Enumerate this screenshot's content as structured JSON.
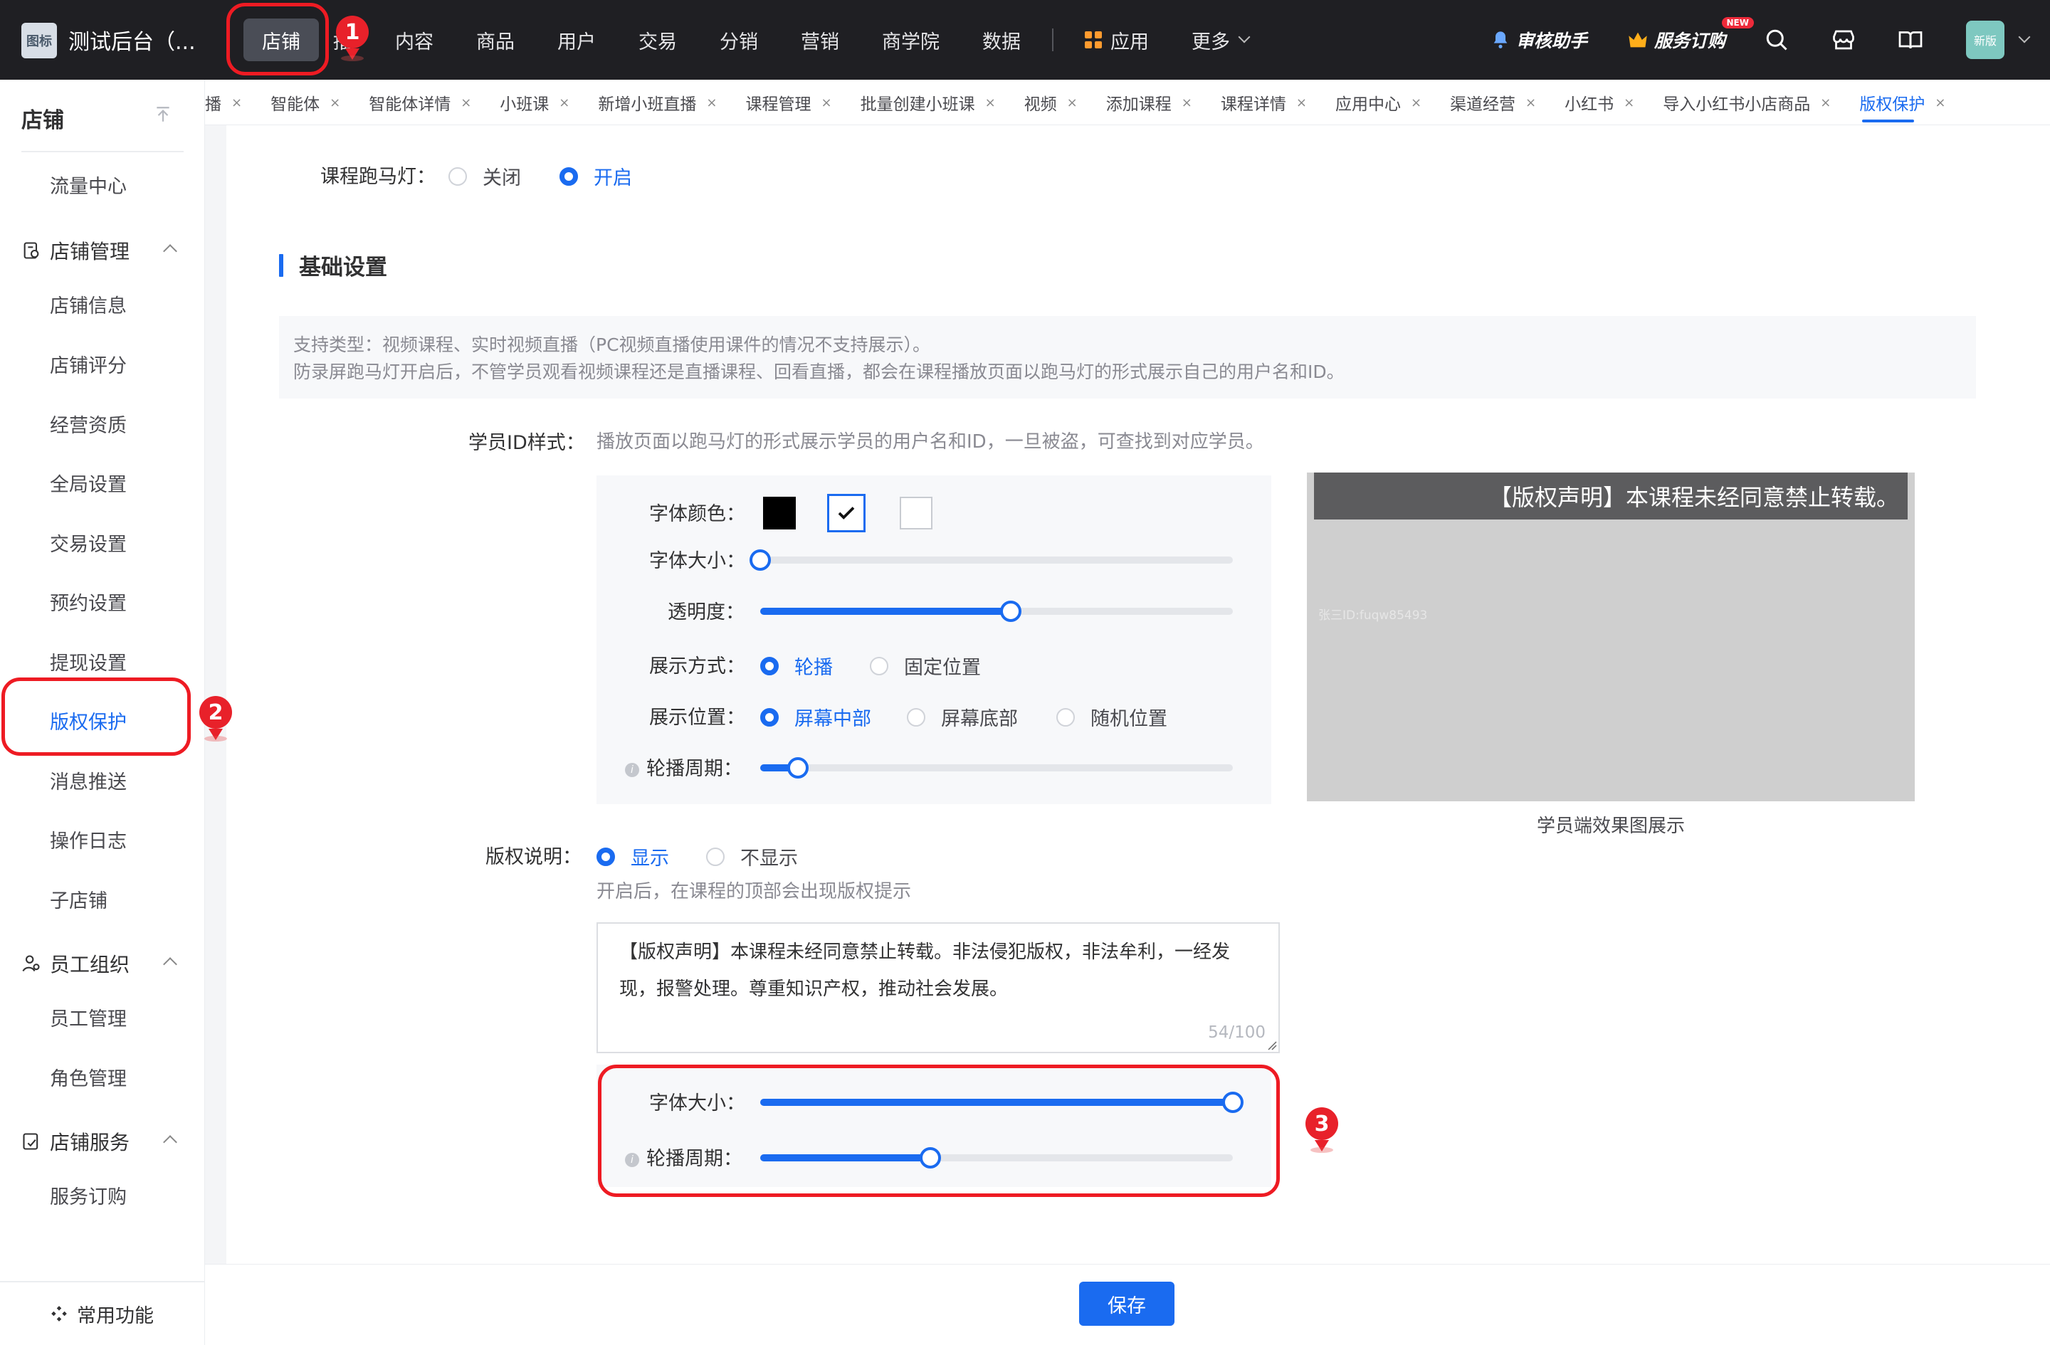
{
  "topnav": {
    "app_title": "测试后台（...",
    "logo_text": "图标",
    "items": [
      {
        "label": "店铺",
        "active": true
      },
      {
        "label": "播"
      },
      {
        "label": "内容"
      },
      {
        "label": "商品"
      },
      {
        "label": "用户"
      },
      {
        "label": "交易"
      },
      {
        "label": "分销"
      },
      {
        "label": "营销"
      },
      {
        "label": "商学院"
      },
      {
        "label": "数据"
      },
      {
        "label": "应用",
        "icon": "apps-grid-icon"
      },
      {
        "label": "更多",
        "icon": "chevron-down-icon"
      }
    ],
    "review_assistant": "审核助手",
    "service_subscribe": "服务订购",
    "new_badge": "NEW",
    "avatar_text": "新版"
  },
  "sidebar": {
    "title": "店铺",
    "items_top": [
      "流量中心"
    ],
    "group_shop_manage": "店铺管理",
    "shop_items": [
      "店铺信息",
      "店铺评分",
      "经营资质",
      "全局设置",
      "交易设置",
      "预约设置",
      "提现设置",
      "版权保护",
      "消息推送",
      "操作日志",
      "子店铺"
    ],
    "group_staff": "员工组织",
    "staff_items": [
      "员工管理",
      "角色管理"
    ],
    "group_service": "店铺服务",
    "service_items": [
      "服务订购"
    ],
    "bottom": "常用功能"
  },
  "tabs": [
    "播",
    "智能体",
    "智能体详情",
    "小班课",
    "新增小班直播",
    "课程管理",
    "批量创建小班课",
    "视频",
    "添加课程",
    "课程详情",
    "应用中心",
    "渠道经营",
    "小红书",
    "导入小红书小店商品",
    "版权保护"
  ],
  "tab_close": "×",
  "form": {
    "marquee_label": "课程跑马灯：",
    "marquee_off": "关闭",
    "marquee_on": "开启",
    "section_title": "基础设置",
    "notice_line1": "支持类型：视频课程、实时视频直播（PC视频直播使用课件的情况不支持展示）。",
    "notice_line2": "防录屏跑马灯开启后，不管学员观看视频课程还是直播课程、回看直播，都会在课程播放页面以跑马灯的形式展示自己的用户名和ID。",
    "student_id_label": "学员ID样式：",
    "student_id_desc": "播放页面以跑马灯的形式展示学员的用户名和ID，一旦被盗，可查找到对应学员。",
    "font_color_label": "字体颜色：",
    "font_size_label": "字体大小：",
    "opacity_label": "透明度：",
    "display_mode_label": "展示方式：",
    "display_mode_options": [
      "轮播",
      "固定位置"
    ],
    "display_pos_label": "展示位置：",
    "display_pos_options": [
      "屏幕中部",
      "屏幕底部",
      "随机位置"
    ],
    "period_label": "轮播周期：",
    "copyright_label": "版权说明：",
    "copyright_show": "显示",
    "copyright_hide": "不显示",
    "copyright_hint": "开启后，在课程的顶部会出现版权提示",
    "copyright_text": "【版权声明】本课程未经同意禁止转载。非法侵犯版权，非法牟利，一经发现，报警处理。尊重知识产权，推动社会发展。",
    "char_counter": "54/100",
    "font_size_label2": "字体大小：",
    "period_label2": "轮播周期：",
    "sliders": {
      "font_size": 0.0,
      "opacity": 0.53,
      "period": 0.08,
      "font_size2": 1.0,
      "period2": 0.36
    }
  },
  "preview": {
    "banner": "【版权声明】本课程未经同意禁止转载。",
    "id_text": "张三ID:fuqw85493",
    "caption": "学员端效果图展示"
  },
  "annotations": [
    "1",
    "2",
    "3"
  ],
  "save_label": "保存",
  "colors": {
    "accent": "#1a6bf0",
    "topnav_bg": "#1f1f23",
    "annotation": "#ee1b23"
  }
}
